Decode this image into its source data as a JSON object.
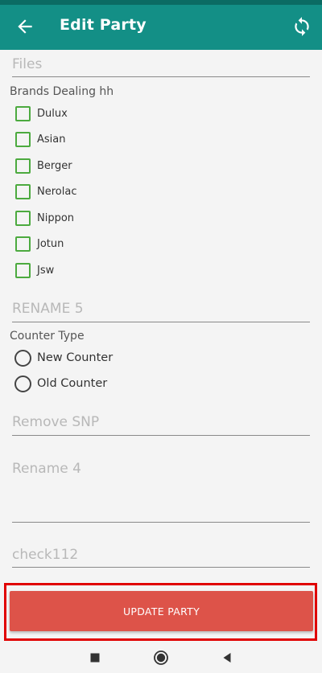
{
  "app_bar": {
    "title": "Edit Party",
    "back_icon": "arrow-left-icon",
    "sync_icon": "sync-icon",
    "color": "#138f86"
  },
  "form": {
    "files_placeholder": "Files",
    "brands_label": "Brands Dealing hh",
    "brands": [
      {
        "label": "Dulux",
        "checked": false
      },
      {
        "label": "Asian",
        "checked": false
      },
      {
        "label": "Berger",
        "checked": false
      },
      {
        "label": "Nerolac",
        "checked": false
      },
      {
        "label": "Nippon",
        "checked": false
      },
      {
        "label": "Jotun",
        "checked": false
      },
      {
        "label": "Jsw",
        "checked": false
      }
    ],
    "rename5_placeholder": "RENAME 5",
    "counter_type_label": "Counter Type",
    "counter_types": [
      {
        "label": "New Counter",
        "selected": false
      },
      {
        "label": "Old Counter",
        "selected": false
      }
    ],
    "remove_snp_placeholder": "Remove SNP",
    "rename4_placeholder": "Rename 4",
    "check112_placeholder": "check112"
  },
  "update_button": {
    "label": "UPDATE PARTY",
    "color": "#dd5349"
  },
  "nav_bar": {
    "icons": [
      "square-recents-icon",
      "circle-home-icon",
      "triangle-back-icon"
    ]
  }
}
